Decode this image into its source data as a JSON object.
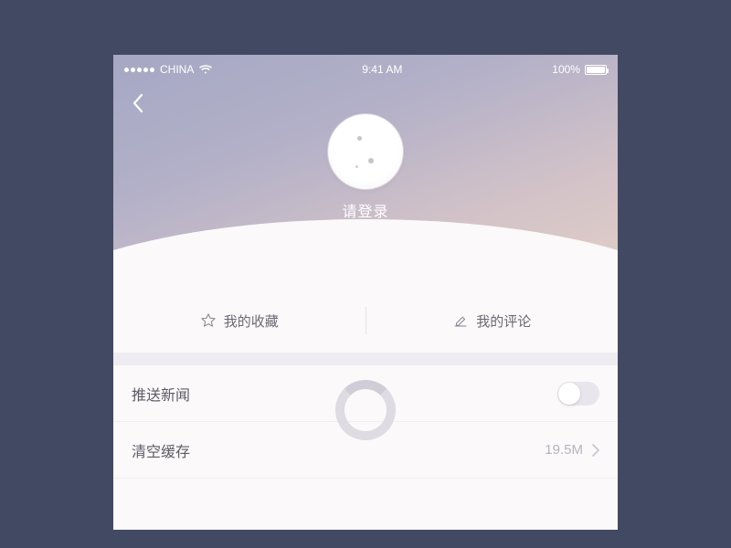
{
  "status": {
    "carrier": "CHINA",
    "time": "9:41 AM",
    "battery": "100%"
  },
  "profile": {
    "login_prompt": "请登录"
  },
  "tabs": {
    "favorites": "我的收藏",
    "comments": "我的评论"
  },
  "settings": {
    "push_news": {
      "label": "推送新闻",
      "on": false
    },
    "clear_cache": {
      "label": "清空缓存",
      "value": "19.5M"
    }
  }
}
